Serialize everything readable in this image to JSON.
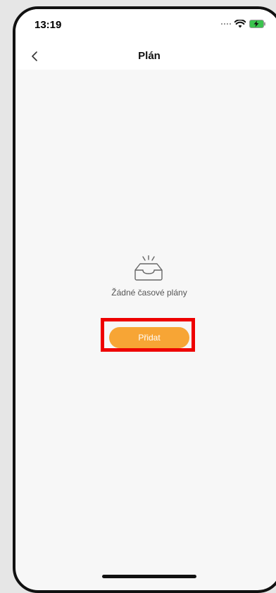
{
  "status_bar": {
    "time": "13:19",
    "icons": [
      "signal-dots-icon",
      "wifi-icon",
      "battery-charging-icon"
    ]
  },
  "nav": {
    "title": "Plán",
    "back_icon": "chevron-left-icon"
  },
  "empty_state": {
    "icon": "empty-inbox-icon",
    "message": "Žádné časové plány"
  },
  "actions": {
    "add_label": "Přidat"
  },
  "colors": {
    "accent": "#f7a535",
    "highlight": "#ee0000",
    "background": "#f7f7f7"
  }
}
